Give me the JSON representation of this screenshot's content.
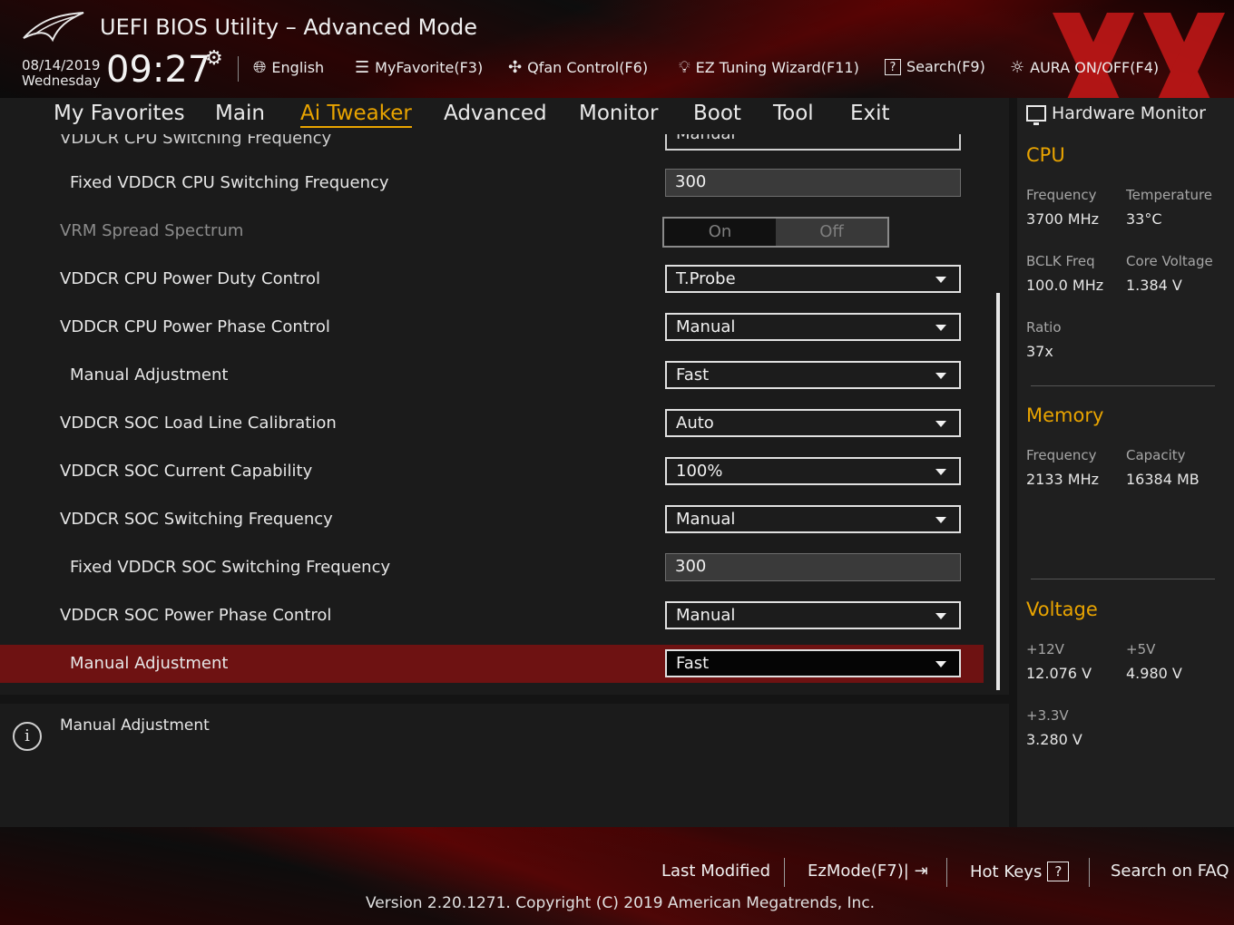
{
  "app": {
    "title": "UEFI BIOS Utility – Advanced Mode",
    "date": "08/14/2019",
    "weekday": "Wednesday",
    "time": "09:27"
  },
  "toolbar": {
    "language": "English",
    "favorite": "MyFavorite(F3)",
    "qfan": "Qfan Control(F6)",
    "ez_tuning": "EZ Tuning Wizard(F11)",
    "search": "Search(F9)",
    "aura": "AURA ON/OFF(F4)"
  },
  "nav": {
    "tabs": [
      "My Favorites",
      "Main",
      "Ai Tweaker",
      "Advanced",
      "Monitor",
      "Boot",
      "Tool",
      "Exit"
    ],
    "active": "Ai Tweaker"
  },
  "settings": {
    "partial_row": {
      "label": "VDDCR CPU Switching Frequency",
      "value": "Manual"
    },
    "rows": [
      {
        "label": "Fixed VDDCR CPU Switching Frequency",
        "value": "300"
      },
      {
        "label": "VRM Spread Spectrum",
        "on": "On",
        "off": "Off"
      },
      {
        "label": "VDDCR CPU Power Duty Control",
        "value": "T.Probe"
      },
      {
        "label": "VDDCR CPU Power Phase Control",
        "value": "Manual"
      },
      {
        "label": "Manual Adjustment",
        "value": "Fast"
      },
      {
        "label": "VDDCR SOC Load Line Calibration",
        "value": "Auto"
      },
      {
        "label": "VDDCR SOC Current Capability",
        "value": "100%"
      },
      {
        "label": "VDDCR SOC Switching Frequency",
        "value": "Manual"
      },
      {
        "label": "Fixed VDDCR SOC Switching Frequency",
        "value": "300"
      },
      {
        "label": "VDDCR SOC Power Phase Control",
        "value": "Manual"
      },
      {
        "label": "Manual Adjustment",
        "value": "Fast"
      }
    ]
  },
  "info": {
    "text": "Manual Adjustment"
  },
  "hw_monitor": {
    "title": "Hardware Monitor",
    "cpu": {
      "heading": "CPU",
      "frequency_label": "Frequency",
      "frequency": "3700 MHz",
      "temperature_label": "Temperature",
      "temperature": "33°C",
      "bclk_label": "BCLK Freq",
      "bclk": "100.0 MHz",
      "core_voltage_label": "Core Voltage",
      "core_voltage": "1.384 V",
      "ratio_label": "Ratio",
      "ratio": "37x"
    },
    "memory": {
      "heading": "Memory",
      "frequency_label": "Frequency",
      "frequency": "2133 MHz",
      "capacity_label": "Capacity",
      "capacity": "16384 MB"
    },
    "voltage": {
      "heading": "Voltage",
      "v12_label": "+12V",
      "v12": "12.076 V",
      "v5_label": "+5V",
      "v5": "4.980 V",
      "v33_label": "+3.3V",
      "v33": "3.280 V"
    }
  },
  "footer": {
    "last_modified": "Last Modified",
    "ezmode": "EzMode(F7)|",
    "hotkeys": "Hot Keys",
    "hotkeys_key": "?",
    "faq": "Search on FAQ",
    "version": "Version 2.20.1271. Copyright (C) 2019 American Megatrends, Inc."
  },
  "colors": {
    "accent": "#e9a400",
    "highlight_row": "#6e1212",
    "panel": "#1b1b1b"
  }
}
